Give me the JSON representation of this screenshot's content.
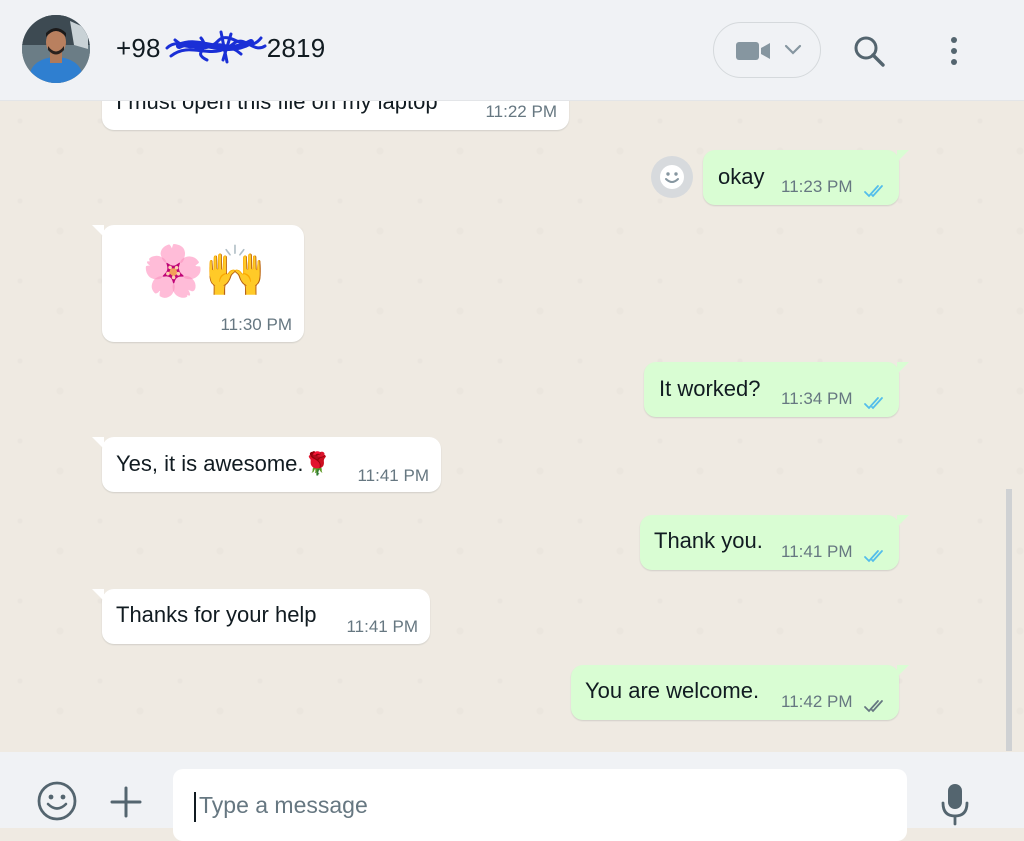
{
  "header": {
    "contact_prefix": "+98",
    "contact_suffix": "2819",
    "icons": [
      "avatar",
      "video-camera-icon",
      "chevron-down-icon",
      "search-icon",
      "kebab-menu-icon"
    ]
  },
  "messages": [
    {
      "direction": "in",
      "text": "I must open this file on my laptop",
      "time": "11:22 PM"
    },
    {
      "direction": "out",
      "text": "okay",
      "time": "11:23 PM",
      "status": "read"
    },
    {
      "direction": "in",
      "text": "🌸🙌",
      "time": "11:30 PM"
    },
    {
      "direction": "out",
      "text": "It worked?",
      "time": "11:34 PM",
      "status": "read"
    },
    {
      "direction": "in",
      "text": "Yes, it is awesome.🌹",
      "time": "11:41 PM"
    },
    {
      "direction": "out",
      "text": "Thank you.",
      "time": "11:41 PM",
      "status": "read"
    },
    {
      "direction": "in",
      "text": "Thanks for your help",
      "time": "11:41 PM"
    },
    {
      "direction": "out",
      "text": "You are welcome.",
      "time": "11:42 PM",
      "status": "delivered"
    }
  ],
  "composer": {
    "placeholder": "Type a message",
    "value": ""
  },
  "colors": {
    "incoming_bubble": "#ffffff",
    "outgoing_bubble": "#d9fdd3",
    "read_tick": "#53bdeb",
    "delivered_tick": "#667781",
    "chat_background": "#efeae2",
    "header_background": "#f0f2f5",
    "redaction_scribble": "#1a2fd6"
  }
}
